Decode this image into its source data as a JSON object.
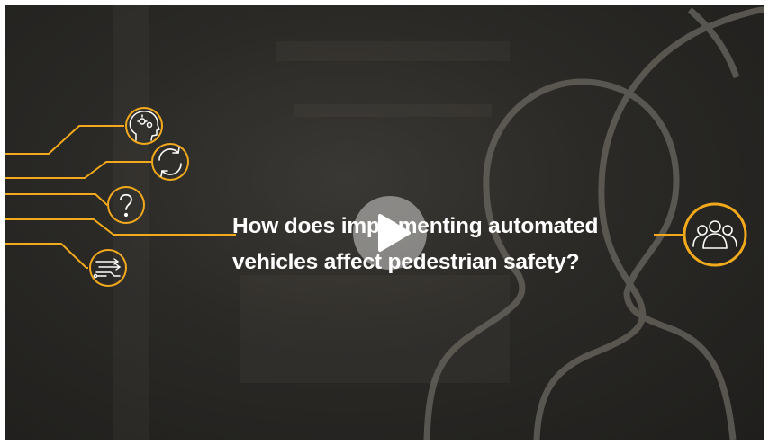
{
  "video": {
    "question_line1": "How does implementing automated",
    "question_line2": "vehicles affect pedestrian safety?",
    "play_label": "Play video"
  },
  "icons": [
    {
      "name": "head-gears-icon"
    },
    {
      "name": "refresh-cycle-icon"
    },
    {
      "name": "question-mark-icon"
    },
    {
      "name": "circuit-arrows-icon"
    },
    {
      "name": "people-group-icon"
    }
  ],
  "colors": {
    "accent": "#f2a91c",
    "background": "#2a2926",
    "text": "#ffffff",
    "outline_watermark": "#6a6760"
  }
}
